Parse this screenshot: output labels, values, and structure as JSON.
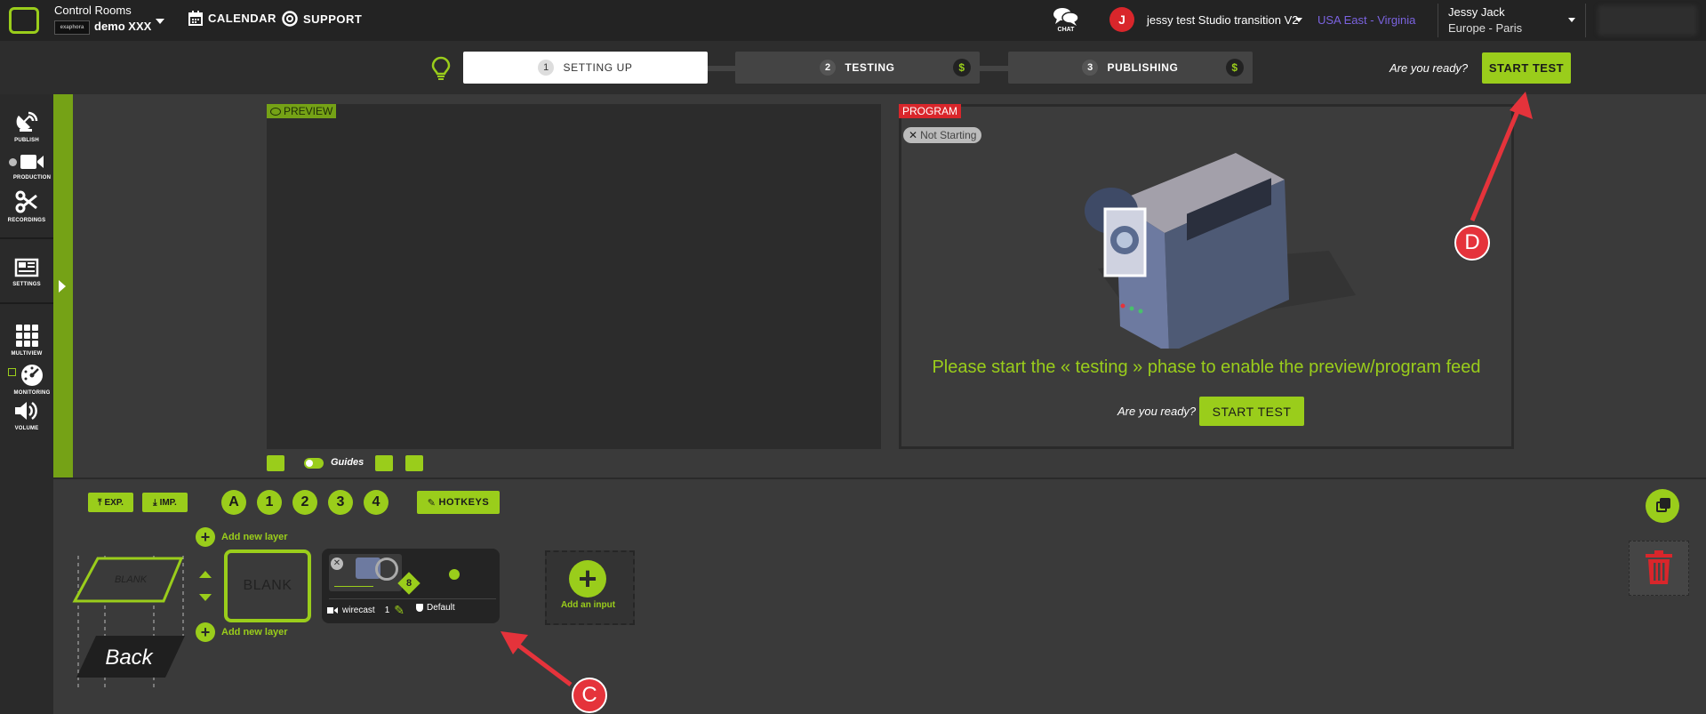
{
  "header": {
    "room_title": "Control Rooms",
    "org_chip": "exaphora",
    "room_name": "demo XXX",
    "nav": [
      {
        "label": "CALENDAR",
        "icon": "calendar-icon"
      },
      {
        "label": "SUPPORT",
        "icon": "support-icon"
      }
    ],
    "chat_label": "CHAT",
    "avatar_letter": "J",
    "studio_name": "jessy test Studio transition V2",
    "region": "USA East - Virginia",
    "user_name": "Jessy Jack",
    "user_timezone": "Europe - Paris"
  },
  "steps": [
    {
      "num": "1",
      "label": "SETTING UP"
    },
    {
      "num": "2",
      "label": "TESTING",
      "badge": "$"
    },
    {
      "num": "3",
      "label": "PUBLISHING",
      "badge": "$"
    }
  ],
  "ready_prompt": "Are you ready?",
  "start_test_label": "START TEST",
  "sidebar": {
    "items": [
      {
        "label": "PUBLISH",
        "icon": "satellite-dish-icon"
      },
      {
        "label": "PRODUCTION",
        "icon": "video-camera-icon"
      },
      {
        "label": "RECORDINGS",
        "icon": "scissors-icon"
      },
      {
        "label": "SETTINGS",
        "icon": "settings-panel-icon"
      },
      {
        "label": "MULTIVIEW",
        "icon": "grid-icon"
      },
      {
        "label": "MONITORING",
        "icon": "gauge-icon"
      },
      {
        "label": "VOLUME",
        "icon": "speaker-icon"
      }
    ]
  },
  "preview": {
    "tag": "PREVIEW",
    "guides_label": "Guides"
  },
  "program": {
    "tag": "PROGRAM",
    "status": "Not Starting",
    "message": "Please start the « testing » phase to enable the preview/program feed"
  },
  "controls": {
    "export_label": "EXP.",
    "import_label": "IMP.",
    "channels": [
      "A",
      "1",
      "2",
      "3",
      "4"
    ],
    "hotkeys_label": "HOTKEYS"
  },
  "layers": {
    "add_layer_label": "Add new layer",
    "blank_label": "BLANK",
    "blank_shape_label": "BLANK",
    "back_label": "Back"
  },
  "input_card": {
    "source": "wirecast",
    "count": "1",
    "preset": "Default",
    "diamond_label": "8"
  },
  "add_input_label": "Add an input",
  "annotations": [
    {
      "label": "C"
    },
    {
      "label": "D"
    }
  ],
  "colors": {
    "accent": "#9acd1b",
    "dark_accent": "#75a216",
    "alert": "#d9262b",
    "region": "#7b63e0",
    "arrow": "#e5333b"
  }
}
